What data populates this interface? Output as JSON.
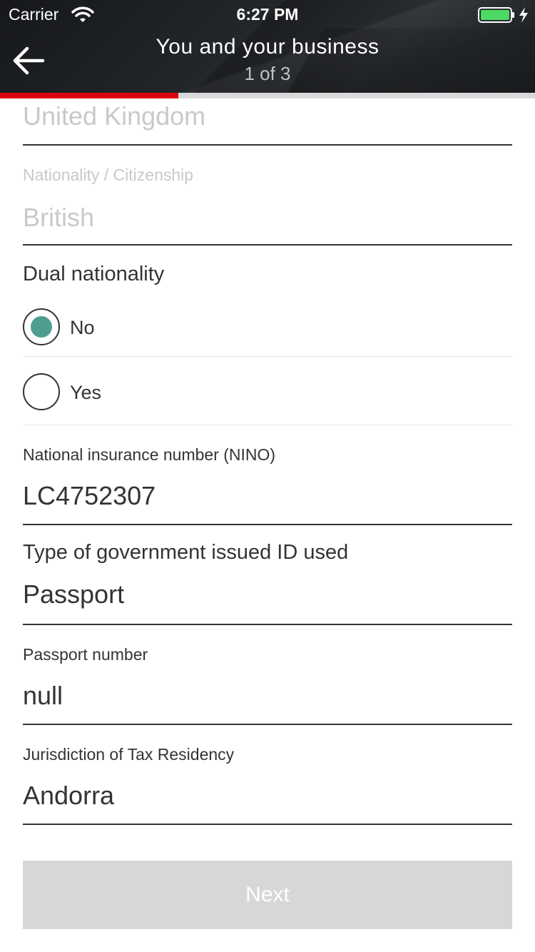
{
  "status_bar": {
    "carrier": "Carrier",
    "time": "6:27 PM",
    "wifi_icon": "wifi-icon",
    "battery_icon": "battery-charging-icon",
    "battery_color": "#4cd964"
  },
  "header": {
    "back_icon": "arrow-left-icon",
    "title": "You and your business",
    "step": "1 of 3",
    "progress_fraction": 0.333,
    "progress_color": "#db0011"
  },
  "form": {
    "country_value": "United Kingdom",
    "nationality": {
      "label": "Nationality / Citizenship",
      "value": "British"
    },
    "dual_nationality": {
      "label": "Dual nationality",
      "options": [
        {
          "label": "No",
          "selected": true
        },
        {
          "label": "Yes",
          "selected": false
        }
      ],
      "selected_color": "#4e9d91"
    },
    "nino": {
      "label": "National insurance number (NINO)",
      "value": "LC4752307"
    },
    "id_type": {
      "label": "Type of government issued ID used",
      "value": "Passport"
    },
    "passport_number": {
      "label": "Passport number",
      "value": "null"
    },
    "tax_residency": {
      "label": "Jurisdiction of Tax Residency",
      "value": "Andorra"
    }
  },
  "next_button": {
    "label": "Next",
    "enabled": false
  }
}
